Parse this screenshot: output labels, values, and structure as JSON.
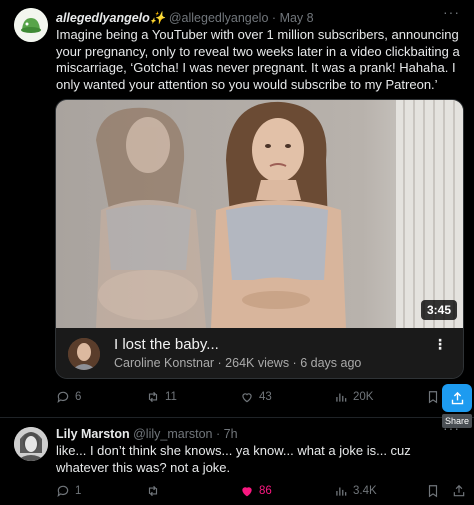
{
  "tweet1": {
    "display_name": "allegedlyangelo✨",
    "handle": "@allegedlyangelo",
    "date": "May 8",
    "separator": "·",
    "more": "···",
    "text": "Imagine being a YouTuber with over 1 million subscribers, announcing your pregnancy, only to reveal two weeks later in a video clickbaiting a miscarriage, ‘Gotcha! I was never pregnant. It was a prank! Hahaha. I only wanted your attention so you would subscribe to my Patreon.’",
    "video": {
      "duration": "3:45",
      "title": "I lost the baby...",
      "channel_line": "Caroline Konstnar · 264K views · 6 days ago",
      "menu": "⋮"
    },
    "actions": {
      "replies": "6",
      "reposts": "11",
      "likes": "43",
      "views": "20K"
    },
    "share_tooltip": "Share"
  },
  "tweet2": {
    "display_name": "Lily Marston",
    "handle": "@lily_marston",
    "date": "7h",
    "separator": "·",
    "more": "···",
    "text": "like... I don’t think she knows... ya know...  what a joke is... cuz whatever this was? not a joke.",
    "actions": {
      "replies": "1",
      "reposts": "",
      "likes": "86",
      "views": "3.4K"
    },
    "like_color": "#f91880"
  },
  "colors": {
    "background": "#000000",
    "text": "#e7e9ea",
    "muted": "#71767b",
    "accent": "#1d9bf0"
  }
}
